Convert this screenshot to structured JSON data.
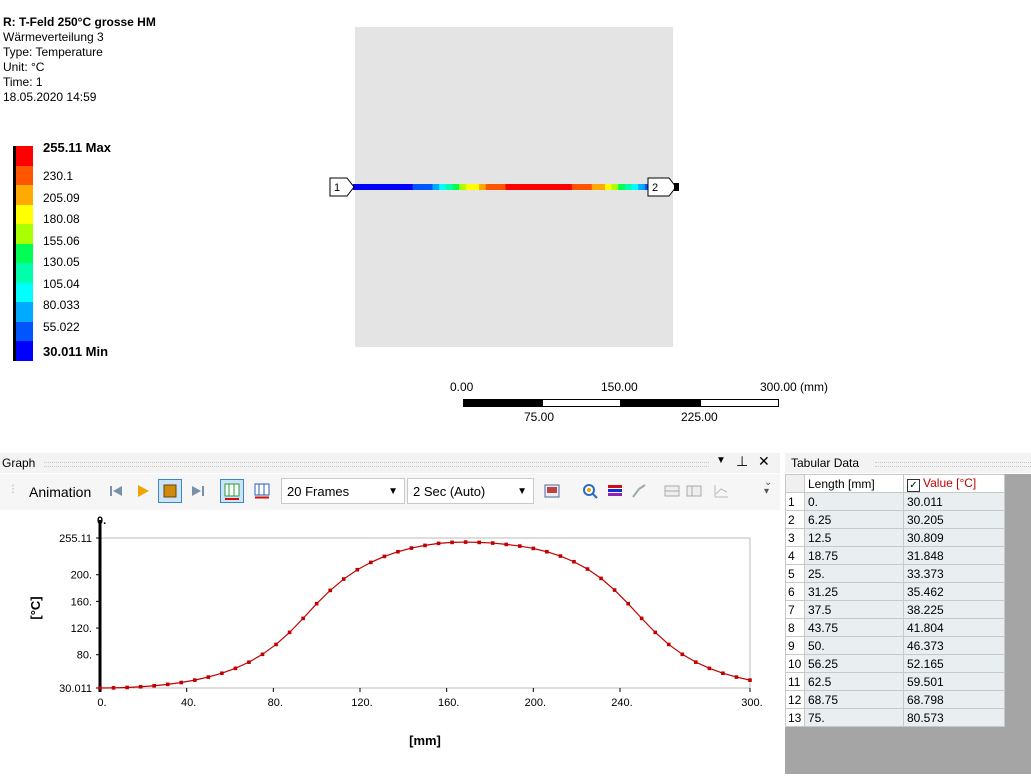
{
  "result": {
    "title": "R: T-Feld 250°C grosse HM",
    "name": "Wärmeverteilung 3",
    "type": "Type: Temperature",
    "unit": "Unit: °C",
    "time": "Time: 1",
    "date": "18.05.2020 14:59"
  },
  "legend": {
    "labels": [
      "255.11 Max",
      "230.1",
      "205.09",
      "180.08",
      "155.06",
      "130.05",
      "105.04",
      "80.033",
      "55.022",
      "30.011 Min"
    ],
    "colors": [
      "#ff0000",
      "#ff5500",
      "#ffaa00",
      "#ffff00",
      "#aaff00",
      "#00ff55",
      "#00ffaa",
      "#00ffff",
      "#00aaff",
      "#0055ff",
      "#0000ff"
    ]
  },
  "probe": {
    "start_label": "1",
    "end_label": "2"
  },
  "scale": {
    "top": [
      "0.00",
      "150.00",
      "300.00 (mm)"
    ],
    "bottom": [
      "75.00",
      "225.00"
    ]
  },
  "graph_panel": {
    "title": "Graph",
    "animation_label": "Animation",
    "frames": "20 Frames",
    "speed": "2 Sec (Auto)",
    "pin_icon": "pin-icon",
    "close_icon": "close-icon"
  },
  "chart_data": {
    "type": "line",
    "x": [
      0,
      6.25,
      12.5,
      18.75,
      25,
      31.25,
      37.5,
      43.75,
      50,
      56.25,
      62.5,
      68.75,
      75,
      81.25,
      87.5,
      93.75,
      100,
      106.25,
      112.5,
      118.75,
      125,
      131.25,
      137.5,
      143.75,
      150,
      156.25,
      162.5,
      168.75,
      175,
      181.25,
      187.5,
      193.75,
      200,
      206.25,
      212.5,
      218.75,
      225,
      231.25,
      237.5,
      243.75,
      250,
      256.25,
      262.5,
      268.75,
      275,
      281.25,
      287.5,
      293.75,
      300
    ],
    "y": [
      30.011,
      30.205,
      30.809,
      31.848,
      33.373,
      35.462,
      38.225,
      41.804,
      46.373,
      52.165,
      59.501,
      68.798,
      80.573,
      95.4,
      113.5,
      134.5,
      156.5,
      176.5,
      193.5,
      207.5,
      218.5,
      227.5,
      234.5,
      240.0,
      244.0,
      247.0,
      248.5,
      249.0,
      248.5,
      247.5,
      245.5,
      243.0,
      239.5,
      234.5,
      228.0,
      219.5,
      208.5,
      194.5,
      177.0,
      156.5,
      134.5,
      113.5,
      95.4,
      80.573,
      68.798,
      59.501,
      52.165,
      46.373,
      41.804
    ],
    "xlabel": "[mm]",
    "ylabel": "[°C]",
    "xticks": [
      "0.",
      "40.",
      "80.",
      "120.",
      "160.",
      "200.",
      "240.",
      "300."
    ],
    "xtick_values": [
      0,
      40,
      80,
      120,
      160,
      200,
      240,
      300
    ],
    "yticks": [
      "255.11",
      "200.",
      "160.",
      "120.",
      "80.",
      "30.011"
    ],
    "ytick_values": [
      255.11,
      200,
      160,
      120,
      80,
      30.011
    ],
    "cursor_label": "0.",
    "xlim": [
      0,
      300
    ],
    "ylim": [
      30.011,
      255.11
    ],
    "line_color": "#c00000"
  },
  "tabular": {
    "title": "Tabular Data",
    "col_length": "Length [mm]",
    "col_value": "Value [°C]",
    "rows": [
      [
        "1",
        "0.",
        "30.011"
      ],
      [
        "2",
        "6.25",
        "30.205"
      ],
      [
        "3",
        "12.5",
        "30.809"
      ],
      [
        "4",
        "18.75",
        "31.848"
      ],
      [
        "5",
        "25.",
        "33.373"
      ],
      [
        "6",
        "31.25",
        "35.462"
      ],
      [
        "7",
        "37.5",
        "38.225"
      ],
      [
        "8",
        "43.75",
        "41.804"
      ],
      [
        "9",
        "50.",
        "46.373"
      ],
      [
        "10",
        "56.25",
        "52.165"
      ],
      [
        "11",
        "62.5",
        "59.501"
      ],
      [
        "12",
        "68.75",
        "68.798"
      ],
      [
        "13",
        "75.",
        "80.573"
      ]
    ]
  }
}
